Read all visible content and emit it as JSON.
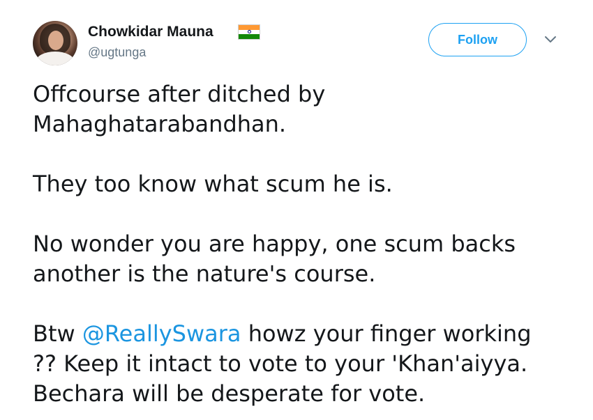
{
  "author": {
    "display_name": "Chowkidar Mauna",
    "handle": "@ugtunga",
    "flag_icon": "india-flag-icon"
  },
  "actions": {
    "follow_label": "Follow",
    "more_icon": "chevron-down-icon"
  },
  "tweet": {
    "para1_line1": "Offcourse after ditched by",
    "para1_line2": "Mahaghatarabandhan.",
    "para2": "They too know what scum he is.",
    "para3_line1": "No wonder you are happy, one scum backs",
    "para3_line2": "another is the nature's course.",
    "para4_prefix": "Btw ",
    "mention": "@ReallySwara",
    "para4_line1_rest": " howz your finger working",
    "para4_line2": "?? Keep it intact to vote to your 'Khan'aiyya.",
    "para4_line3": "Bechara will be desperate for vote."
  },
  "colors": {
    "link": "#1b95e0",
    "follow_accent": "#1da1f2",
    "secondary_text": "#657786",
    "primary_text": "#14171a"
  }
}
